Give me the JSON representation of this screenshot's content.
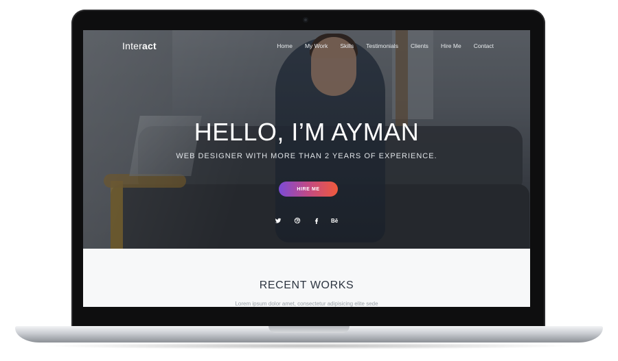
{
  "site": {
    "logo": {
      "light": "Inter",
      "bold": "act"
    },
    "nav": [
      "Home",
      "My Work",
      "Skills",
      "Testimonials",
      "Clients",
      "Hire Me",
      "Contact"
    ]
  },
  "hero": {
    "title": "HELLO, I’M AYMAN",
    "subtitle": "WEB DESIGNER WITH MORE THAN 2 YEARS OF EXPERIENCE.",
    "cta": "HIRE ME",
    "social_icons": [
      "twitter-icon",
      "dribbble-icon",
      "facebook-icon",
      "behance-icon"
    ]
  },
  "section": {
    "title": "RECENT WORKS",
    "subtitle": "Lorem ipsum dolor amet, consectetur adipisicing elite sede"
  },
  "colors": {
    "cta_gradient_start": "#7b4bd6",
    "cta_gradient_end": "#f05a3c"
  }
}
